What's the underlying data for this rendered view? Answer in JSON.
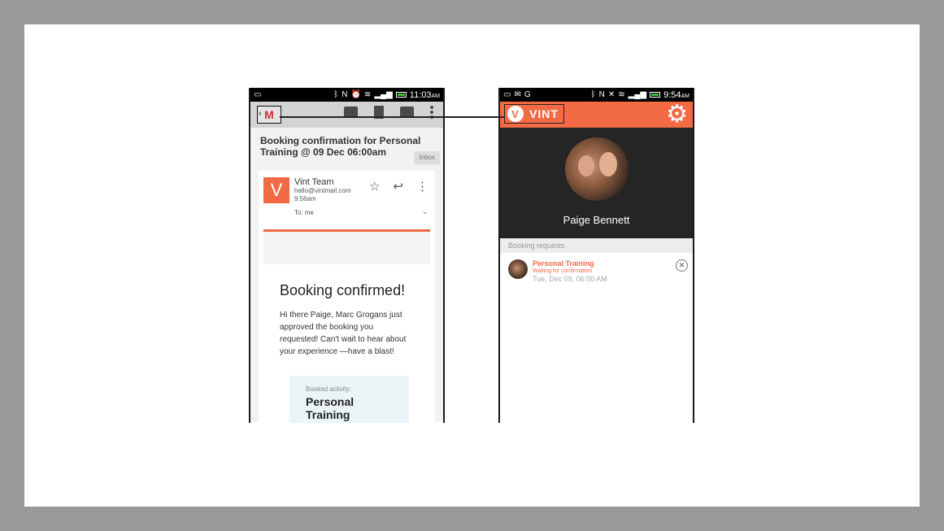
{
  "left_phone": {
    "status": {
      "time": "11:03",
      "ampm": "AM"
    },
    "toolbar": {
      "back_logo": "M",
      "actions": [
        "archive-icon",
        "trash-icon",
        "mail-icon",
        "overflow-icon"
      ]
    },
    "subject": "Booking confirmation for Personal Training @ 09 Dec 06:00am",
    "label": "Inbox",
    "sender": {
      "avatar_letter": "V",
      "name": "Vint Team",
      "email": "hello@vintmail.com",
      "time": "9:56am",
      "to": "To: me"
    },
    "email": {
      "heading": "Booking confirmed!",
      "body": "Hi there Paige, Marc Grogans just approved the booking you requested! Can't wait to hear about your experience —have a blast!",
      "booked_label": "Booked activity:",
      "booked_activity": "Personal Training"
    }
  },
  "right_phone": {
    "status": {
      "time": "9:54",
      "ampm": "AM"
    },
    "app_name": "VINT",
    "logo_letter": "V",
    "profile_name": "Paige Bennett",
    "section_header": "Booking requests",
    "request": {
      "title": "Personal Training",
      "status": "Waiting for confirmation",
      "date": "Tue, Dec 09, 06:00 AM"
    }
  },
  "colors": {
    "accent": "#f26b45",
    "dark": "#252525"
  }
}
